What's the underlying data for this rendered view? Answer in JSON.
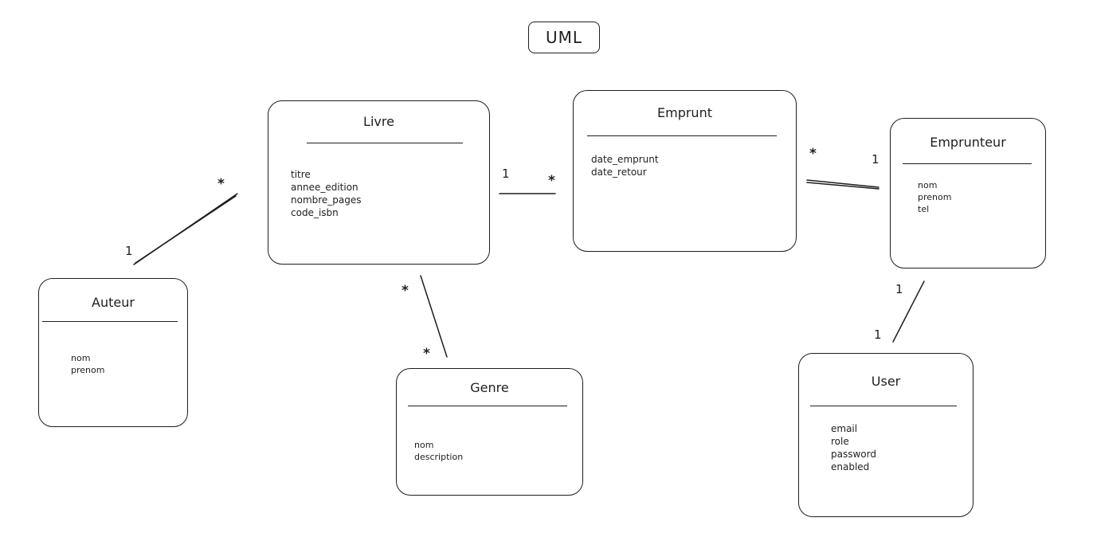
{
  "title": "UML",
  "classes": {
    "livre": {
      "name": "Livre",
      "attributes": [
        "titre",
        "annee_edition",
        "nombre_pages",
        "code_isbn"
      ]
    },
    "emprunt": {
      "name": "Emprunt",
      "attributes": [
        "date_emprunt",
        "date_retour"
      ]
    },
    "emprunteur": {
      "name": "Emprunteur",
      "attributes": [
        "nom",
        "prenom",
        "tel"
      ]
    },
    "auteur": {
      "name": "Auteur",
      "attributes": [
        "nom",
        "prenom"
      ]
    },
    "genre": {
      "name": "Genre",
      "attributes": [
        "nom",
        "description"
      ]
    },
    "user": {
      "name": "User",
      "attributes": [
        "email",
        "role",
        "password",
        "enabled"
      ]
    }
  },
  "associations": {
    "livre_auteur": {
      "near_livre": "*",
      "near_auteur": "1"
    },
    "livre_emprunt": {
      "near_livre": "1",
      "near_emprunt": "*"
    },
    "emprunt_emprunteur": {
      "near_emprunt": "*",
      "near_emprunteur": "1"
    },
    "livre_genre": {
      "near_livre": "*",
      "near_genre": "*"
    },
    "emprunteur_user": {
      "near_emprunteur": "1",
      "near_user": "1"
    }
  }
}
